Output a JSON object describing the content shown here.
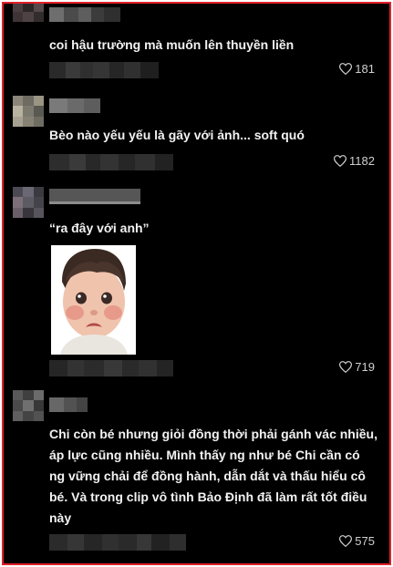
{
  "comments": [
    {
      "text": "coi hậu trường mà muốn lên thuyền liền",
      "likes": "181"
    },
    {
      "text": "Bèo nào yếu yếu là gãy với ảnh... soft quó",
      "likes": "1182"
    },
    {
      "text": "“ra đây với anh”",
      "likes": "719"
    },
    {
      "text": "Chi còn bé nhưng giỏi đồng thời phải gánh vác nhiều, áp lực cũng nhiều. Mình thấy ng như bé Chi cần có ng vững chải để đồng hành, dẫn dắt và thấu hiểu cô bé. Và trong clip vô tình Bảo Định đã làm rất tốt điều này",
      "likes": "575"
    }
  ],
  "icons": {
    "like": "heart-outline-icon"
  },
  "colors": {
    "background": "#000000",
    "border": "#e0202a",
    "text": "#f2f2f2"
  }
}
